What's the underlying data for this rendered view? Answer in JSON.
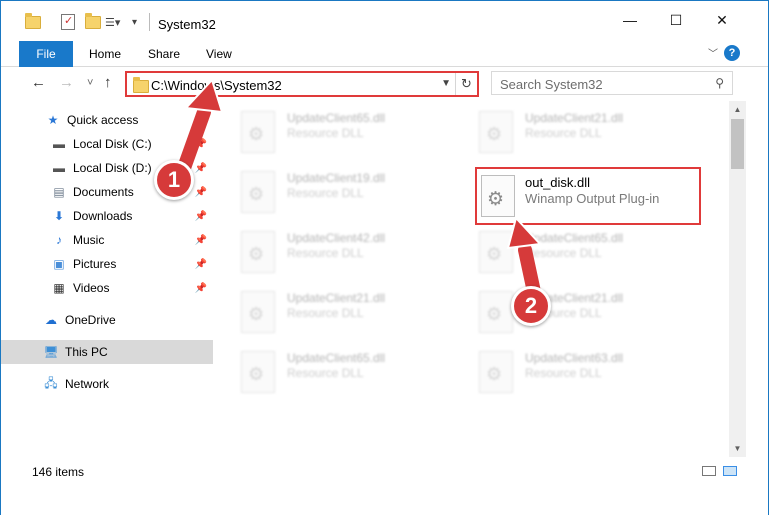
{
  "window": {
    "title": "System32",
    "controls": {
      "minimize": "—",
      "maximize": "☐",
      "close": "✕"
    }
  },
  "ribbon": {
    "tabs": [
      "File",
      "Home",
      "Share",
      "View"
    ],
    "help": "?"
  },
  "navigation": {
    "back": "←",
    "forward": "→",
    "recent": "˅",
    "up": "↑",
    "address": "C:\\Windows\\System32",
    "search_placeholder": "Search System32"
  },
  "sidebar": {
    "items": [
      {
        "label": "Quick access",
        "icon": "star-icon"
      },
      {
        "label": "Local Disk (C:)",
        "icon": "drive-icon",
        "pinned": true
      },
      {
        "label": "Local Disk (D:)",
        "icon": "drive-icon",
        "pinned": true
      },
      {
        "label": "Documents",
        "icon": "documents-icon",
        "pinned": true
      },
      {
        "label": "Downloads",
        "icon": "download-icon",
        "pinned": true
      },
      {
        "label": "Music",
        "icon": "music-icon",
        "pinned": true
      },
      {
        "label": "Pictures",
        "icon": "pictures-icon",
        "pinned": true
      },
      {
        "label": "Videos",
        "icon": "videos-icon",
        "pinned": true
      },
      {
        "label": "OneDrive",
        "icon": "cloud-icon"
      },
      {
        "label": "This PC",
        "icon": "computer-icon",
        "selected": true
      },
      {
        "label": "Network",
        "icon": "network-icon"
      }
    ]
  },
  "files": {
    "left": [
      {
        "name": "UpdateClient65.dll",
        "desc": "Resource DLL"
      },
      {
        "name": "UpdateClient19.dll",
        "desc": "Resource DLL"
      },
      {
        "name": "UpdateClient42.dll",
        "desc": "Resource DLL"
      },
      {
        "name": "UpdateClient21.dll",
        "desc": "Resource DLL"
      },
      {
        "name": "UpdateClient65.dll",
        "desc": "Resource DLL"
      }
    ],
    "right": [
      {
        "name": "UpdateClient21.dll",
        "desc": "Resource DLL"
      },
      {
        "name": "UpdateClient65.dll",
        "desc": "Resource DLL"
      },
      {
        "name": "UpdateClient21.dll",
        "desc": "Resource DLL"
      },
      {
        "name": "UpdateClient63.dll",
        "desc": "Resource DLL"
      }
    ],
    "highlighted": {
      "name": "out_disk.dll",
      "desc": "Winamp Output Plug-in"
    }
  },
  "status": {
    "item_count": "146 items"
  },
  "annotations": {
    "step1": "1",
    "step2": "2",
    "color": "#d63a3a"
  }
}
